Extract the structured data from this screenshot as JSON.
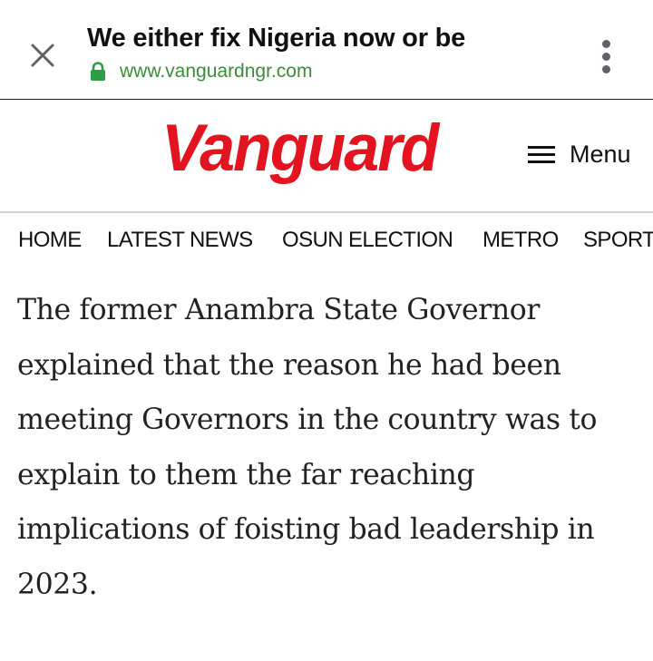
{
  "browser": {
    "page_title": "We either fix Nigeria now or be",
    "url": "www.vanguardngr.com",
    "icons": {
      "close": "close-icon",
      "lock": "lock-icon",
      "menu": "more-vertical-icon"
    }
  },
  "site": {
    "logo_text": "Vanguard",
    "menu_label": "Menu",
    "brand_color": "#e3141f"
  },
  "nav": {
    "items": [
      {
        "label": "HOME"
      },
      {
        "label": "LATEST NEWS"
      },
      {
        "label": "OSUN ELECTION"
      },
      {
        "label": "METRO"
      },
      {
        "label": "SPORT"
      }
    ]
  },
  "article": {
    "paragraph": "The former Anambra State Governor explained that the reason he had been meeting Governors in the country was to explain to them the far reaching implications of foisting bad leadership in 2023."
  }
}
